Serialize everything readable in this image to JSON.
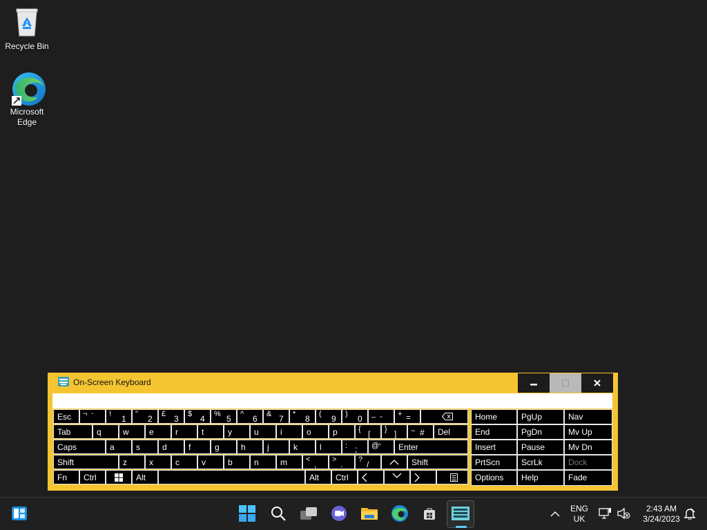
{
  "desktop": {
    "icons": [
      {
        "label": "Recycle Bin"
      },
      {
        "label": "Microsoft Edge"
      }
    ]
  },
  "osk": {
    "title": "On-Screen Keyboard",
    "window_buttons": {
      "minimize": "minimize",
      "maximize": "maximize",
      "close": "close"
    },
    "row1": [
      {
        "up": "¬",
        "dn": "`"
      },
      {
        "up": "!",
        "dn": "1"
      },
      {
        "up": "\"",
        "dn": "2"
      },
      {
        "up": "£",
        "dn": "3"
      },
      {
        "up": "$",
        "dn": "4"
      },
      {
        "up": "%",
        "dn": "5"
      },
      {
        "up": "^",
        "dn": "6"
      },
      {
        "up": "&",
        "dn": "7"
      },
      {
        "up": "*",
        "dn": "8"
      },
      {
        "up": "(",
        "dn": "9"
      },
      {
        "up": ")",
        "dn": "0"
      },
      {
        "up": "_",
        "dn": "-"
      },
      {
        "up": "+",
        "dn": "="
      }
    ],
    "row1_labels": {
      "esc": "Esc"
    },
    "row2_labels": {
      "tab": "Tab",
      "q": "q",
      "w": "w",
      "e": "e",
      "r": "r",
      "t": "t",
      "y": "y",
      "u": "u",
      "i": "i",
      "o": "o",
      "p": "p",
      "del": "Del"
    },
    "row2_sym": [
      {
        "up": "{",
        "dn": "["
      },
      {
        "up": "}",
        "dn": "]"
      },
      {
        "up": "~",
        "dn": "#"
      }
    ],
    "row3_labels": {
      "caps": "Caps",
      "a": "a",
      "s": "s",
      "d": "d",
      "f": "f",
      "g": "g",
      "h": "h",
      "j": "j",
      "k": "k",
      "l": "l",
      "enter": "Enter"
    },
    "row3_sym": [
      {
        "up": ":",
        "dn": ";"
      },
      {
        "up": "@",
        "dn": "'"
      }
    ],
    "row4_labels": {
      "shift_l": "Shift",
      "z": "z",
      "x": "x",
      "c": "c",
      "v": "v",
      "b": "b",
      "n": "n",
      "m": "m",
      "shift_r": "Shift"
    },
    "row4_sym": [
      {
        "up": "<",
        "dn": ","
      },
      {
        "up": ">",
        "dn": "."
      },
      {
        "up": "?",
        "dn": "/"
      }
    ],
    "row5_labels": {
      "fn": "Fn",
      "ctrl_l": "Ctrl",
      "alt_l": "Alt",
      "alt_r": "Alt",
      "ctrl_r": "Ctrl"
    },
    "nav": {
      "home": "Home",
      "pgup": "PgUp",
      "nav": "Nav",
      "end": "End",
      "pgdn": "PgDn",
      "mvup": "Mv Up",
      "insert": "Insert",
      "pause": "Pause",
      "mvdn": "Mv Dn",
      "prtscn": "PrtScn",
      "scrlk": "ScrLk",
      "dock": "Dock",
      "options": "Options",
      "help": "Help",
      "fade": "Fade"
    }
  },
  "taskbar": {
    "language": {
      "line1": "ENG",
      "line2": "UK"
    },
    "clock": {
      "time": "2:43 AM",
      "date": "3/24/2023"
    }
  },
  "colors": {
    "osk_frame": "#f5c531",
    "key_bg": "#000000",
    "taskbar": "#202020",
    "desktop": "#1e1e1e"
  }
}
